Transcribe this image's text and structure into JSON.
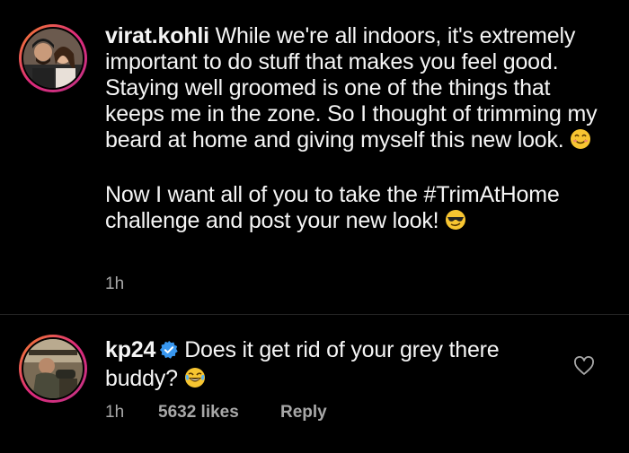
{
  "post": {
    "username": "virat.kohli",
    "caption_line1": "While we're all indoors, it's extremely important to do stuff that makes you feel good. Staying well groomed is one of the things that keeps me in the zone. So I thought of trimming my beard at home and giving myself this new look.",
    "caption_line2": "Now I want all of you to take the #TrimAtHome challenge and post your new look!",
    "time": "1h"
  },
  "comment": {
    "username": "kp24",
    "text": "Does it get rid of your grey there buddy?",
    "time": "1h",
    "likes": "5632 likes",
    "reply_label": "Reply"
  },
  "icons": {
    "smile": "smiling-face-icon",
    "cool": "sunglasses-face-icon",
    "laugh": "tears-of-joy-icon",
    "verified": "verified-badge-icon",
    "heart": "heart-outline-icon"
  },
  "colors": {
    "verified": "#3897f0",
    "emoji": "#f7c531",
    "text": "#f5f5f5",
    "muted": "#a8a8a8"
  }
}
